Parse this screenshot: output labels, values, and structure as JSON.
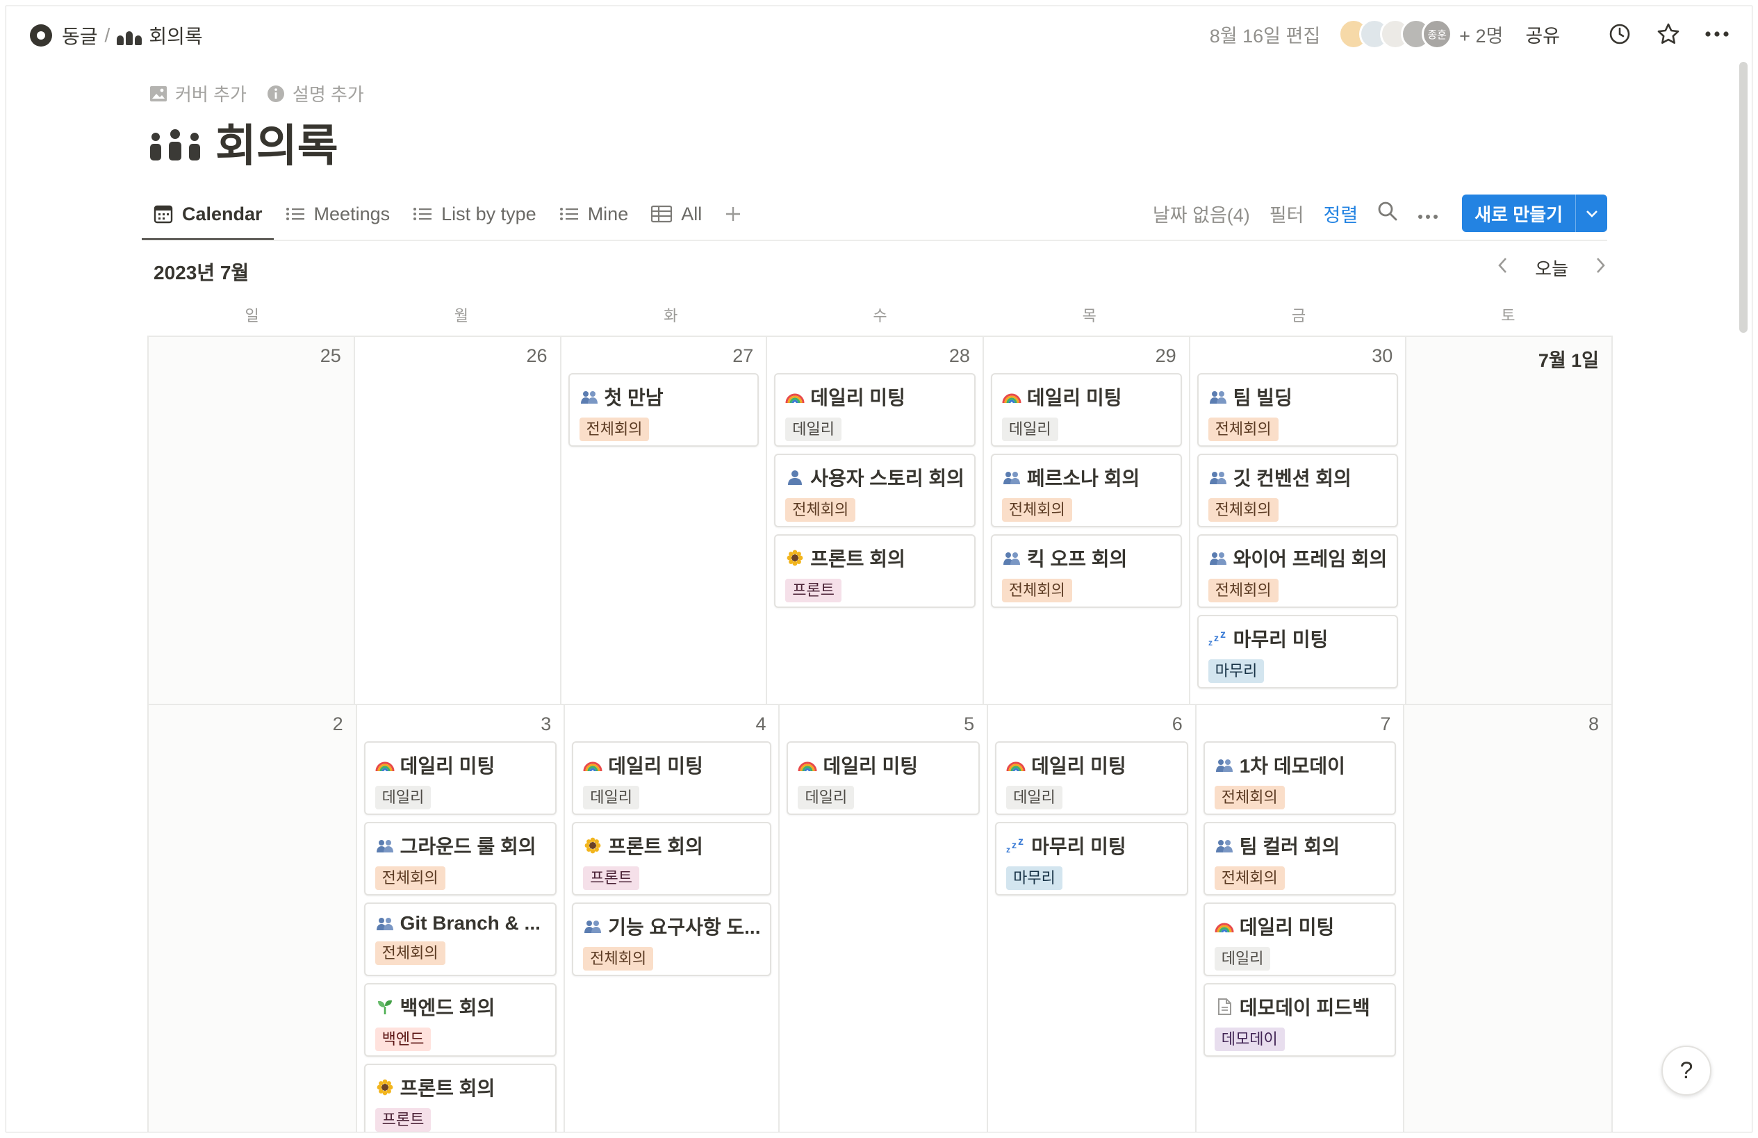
{
  "breadcrumb": {
    "workspace": "동글",
    "separator": "/",
    "page": "회의록"
  },
  "topbar": {
    "edited": "8월 16일 편집",
    "avatar_label": "종훈",
    "more_people": "+ 2명",
    "share": "공유"
  },
  "page": {
    "add_cover": "커버 추가",
    "add_description": "설명 추가",
    "title": "회의록"
  },
  "tabs": [
    {
      "label": "Calendar",
      "icon": "calendar-icon"
    },
    {
      "label": "Meetings",
      "icon": "list-icon"
    },
    {
      "label": "List by type",
      "icon": "list-icon"
    },
    {
      "label": "Mine",
      "icon": "list-icon"
    },
    {
      "label": "All",
      "icon": "table-icon"
    }
  ],
  "view_actions": {
    "no_date": "날짜 없음(4)",
    "filter": "필터",
    "sort": "정렬",
    "new_button": "새로 만들기"
  },
  "calendar": {
    "month_label": "2023년 7월",
    "today": "오늘",
    "weekdays": [
      "일",
      "월",
      "화",
      "수",
      "목",
      "금",
      "토"
    ],
    "weeks": [
      {
        "days": [
          {
            "num": "25",
            "events": []
          },
          {
            "num": "26",
            "events": []
          },
          {
            "num": "27",
            "events": [
              {
                "title": "첫 만남",
                "icon": "people-icon",
                "tag": "전체회의"
              }
            ]
          },
          {
            "num": "28",
            "events": [
              {
                "title": "데일리 미팅",
                "icon": "rainbow-icon",
                "tag": "데일리"
              },
              {
                "title": "사용자 스토리 회의",
                "icon": "person-icon",
                "tag": "전체회의"
              },
              {
                "title": "프론트 회의",
                "icon": "sunflower-icon",
                "tag": "프론트"
              }
            ]
          },
          {
            "num": "29",
            "events": [
              {
                "title": "데일리 미팅",
                "icon": "rainbow-icon",
                "tag": "데일리"
              },
              {
                "title": "페르소나 회의",
                "icon": "people-icon",
                "tag": "전체회의"
              },
              {
                "title": "킥 오프 회의",
                "icon": "people-icon",
                "tag": "전체회의"
              }
            ]
          },
          {
            "num": "30",
            "events": [
              {
                "title": "팀 빌딩",
                "icon": "people-icon",
                "tag": "전체회의"
              },
              {
                "title": "깃 컨벤션 회의",
                "icon": "people-icon",
                "tag": "전체회의"
              },
              {
                "title": "와이어 프레임 회의",
                "icon": "people-icon",
                "tag": "전체회의"
              },
              {
                "title": "마무리 미팅",
                "icon": "zzz-icon",
                "tag": "마무리"
              }
            ]
          },
          {
            "num": "7월 1일",
            "events": []
          }
        ]
      },
      {
        "days": [
          {
            "num": "2",
            "events": []
          },
          {
            "num": "3",
            "events": [
              {
                "title": "데일리 미팅",
                "icon": "rainbow-icon",
                "tag": "데일리"
              },
              {
                "title": "그라운드 룰 회의",
                "icon": "people-icon",
                "tag": "전체회의"
              },
              {
                "title": "Git Branch & ...",
                "icon": "people-icon",
                "tag": "전체회의"
              },
              {
                "title": "백엔드 회의",
                "icon": "seedling-icon",
                "tag": "백엔드"
              },
              {
                "title": "프론트 회의",
                "icon": "sunflower-icon",
                "tag": "프론트"
              }
            ]
          },
          {
            "num": "4",
            "events": [
              {
                "title": "데일리 미팅",
                "icon": "rainbow-icon",
                "tag": "데일리"
              },
              {
                "title": "프론트 회의",
                "icon": "sunflower-icon",
                "tag": "프론트"
              },
              {
                "title": "기능 요구사항 도...",
                "icon": "people-icon",
                "tag": "전체회의"
              }
            ]
          },
          {
            "num": "5",
            "events": [
              {
                "title": "데일리 미팅",
                "icon": "rainbow-icon",
                "tag": "데일리"
              }
            ]
          },
          {
            "num": "6",
            "events": [
              {
                "title": "데일리 미팅",
                "icon": "rainbow-icon",
                "tag": "데일리"
              },
              {
                "title": "마무리 미팅",
                "icon": "zzz-icon",
                "tag": "마무리"
              }
            ]
          },
          {
            "num": "7",
            "events": [
              {
                "title": "1차 데모데이",
                "icon": "people-icon",
                "tag": "전체회의"
              },
              {
                "title": "팀 컬러 회의",
                "icon": "people-icon",
                "tag": "전체회의"
              },
              {
                "title": "데일리 미팅",
                "icon": "rainbow-icon",
                "tag": "데일리"
              },
              {
                "title": "데모데이 피드백",
                "icon": "document-icon",
                "tag": "데모데이"
              }
            ]
          },
          {
            "num": "8",
            "events": []
          }
        ]
      }
    ]
  },
  "tag_colors": {
    "전체회의": {
      "bg": "#fadec9",
      "fg": "#5c3b23"
    },
    "데일리": {
      "bg": "#eeeeec",
      "fg": "#4d4a45"
    },
    "프론트": {
      "bg": "#f5e0e9",
      "fg": "#4c2337"
    },
    "마무리": {
      "bg": "#d3e5ef",
      "fg": "#183347"
    },
    "백엔드": {
      "bg": "#ffe2dd",
      "fg": "#5d1715"
    },
    "데모데이": {
      "bg": "#e8deee",
      "fg": "#412454"
    }
  },
  "help": "?"
}
